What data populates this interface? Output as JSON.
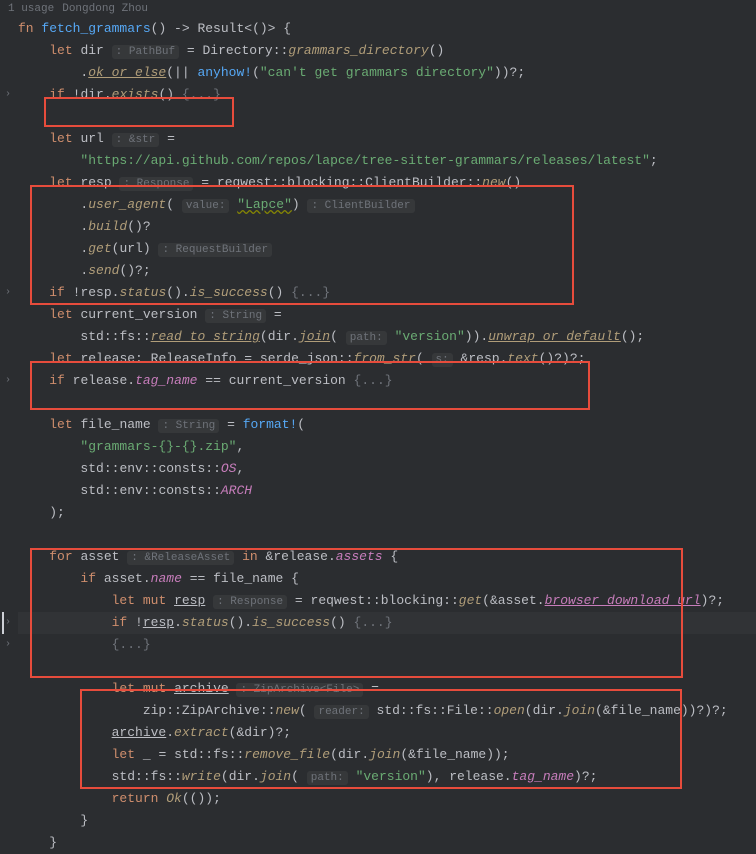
{
  "header": {
    "usage": "1 usage",
    "author": "Dongdong Zhou"
  },
  "code": {
    "fn_kw": "fn",
    "fn_name": "fetch_grammars",
    "return_arrow": "-> ",
    "result_type": "Result",
    "unit": "<()>",
    "let_kw": "let",
    "mut_kw": "mut",
    "if_kw": "if",
    "for_kw": "for",
    "in_kw": "in",
    "return_kw": "return",
    "dir_var": "dir",
    "pathbuf_hint": ": PathBuf",
    "directory": "Directory",
    "grammars_dir_fn": "grammars_directory",
    "ok_or_else": "ok_or_else",
    "anyhow": "anyhow!",
    "err_str": "\"can't get grammars directory\"",
    "exists": "exists",
    "fold_braces": "{...}",
    "url_var": "url",
    "str_hint": ": &str",
    "url_str": "\"https://api.github.com/repos/lapce/tree-sitter-grammars/releases/latest\"",
    "resp_var": "resp",
    "response_hint": ": Response",
    "reqwest": "reqwest",
    "blocking": "blocking",
    "client_builder": "ClientBuilder",
    "new_fn": "new",
    "user_agent": "user_agent",
    "value_hint": "value:",
    "lapce_str": "\"Lapce\"",
    "cb_hint": ": ClientBuilder",
    "build": "build",
    "get": "get",
    "rb_hint": ": RequestBuilder",
    "send": "send",
    "status": "status",
    "is_success": "is_success",
    "current_version": "current_version",
    "string_hint": ": String",
    "std": "std",
    "fs": "fs",
    "read_to_string": "read_to_string",
    "join": "join",
    "path_hint": "path:",
    "version_str": "\"version\"",
    "unwrap_or_default": "unwrap_or_default",
    "release_var": "release",
    "release_info": "ReleaseInfo",
    "serde_json": "serde_json",
    "from_str": "from_str",
    "s_hint": "s:",
    "text": "text",
    "tag_name": "tag_name",
    "file_name": "file_name",
    "format": "format!",
    "grammars_fmt": "\"grammars-{}-{}.zip\"",
    "env": "env",
    "consts": "consts",
    "os_c": "OS",
    "arch_c": "ARCH",
    "asset_var": "asset",
    "ra_hint": ": &ReleaseAsset",
    "assets_field": "assets",
    "name_field": "name",
    "browser_url": "browser_download_url",
    "archive_var": "archive",
    "za_hint": ": ZipArchive<File>",
    "zip": "zip",
    "zip_archive": "ZipArchive",
    "reader_hint": "reader:",
    "file_type": "File",
    "open_fn": "open",
    "extract": "extract",
    "underscore": "_",
    "remove_file": "remove_file",
    "write": "write",
    "ok_enum": "Ok"
  }
}
